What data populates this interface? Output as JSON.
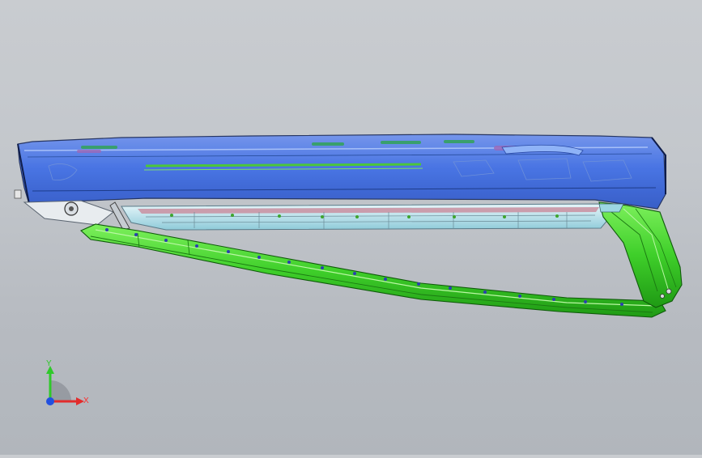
{
  "viewport": {
    "background_top": "#c9ccd0",
    "background_bottom": "#b1b6bc"
  },
  "model": {
    "colors": {
      "blue_body": "#3f6ee6",
      "blue_highlight": "#7fa4f5",
      "green_rail": "#3fcf2a",
      "lightblue_sill": "#aee0ec",
      "edge_dark": "#1a2a5a"
    }
  },
  "triad": {
    "y_label": "Y",
    "x_label": "X",
    "y_color": "#2fc92a",
    "x_color": "#e22c2c",
    "z_color": "#2250e0"
  }
}
